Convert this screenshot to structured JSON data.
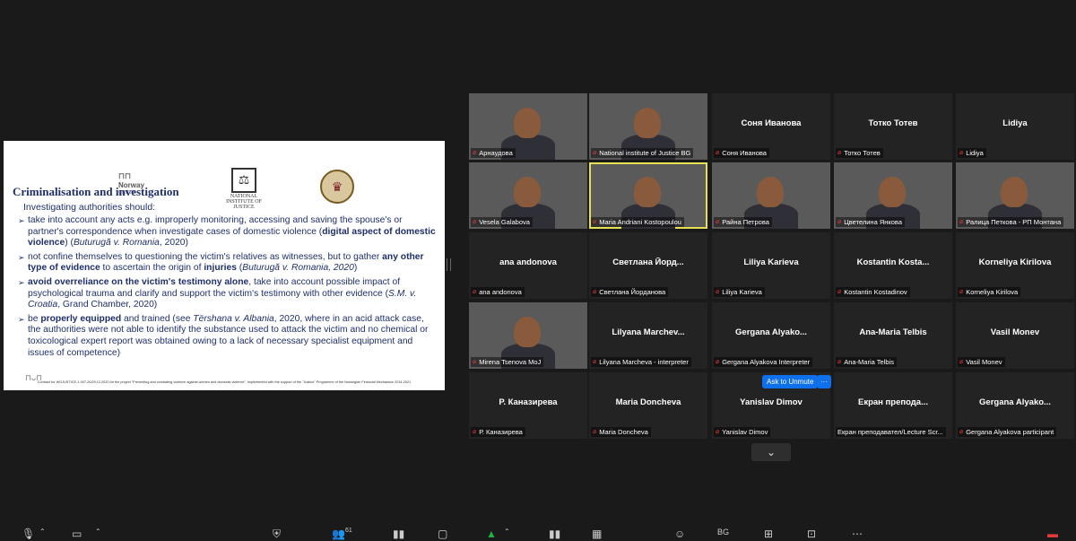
{
  "slide": {
    "logo_norway": "Norway",
    "logo_norway_sub": "grants",
    "logo_nij": "NATIONAL INSTITUTE OF JUSTICE",
    "title": "Criminalisation and investigation",
    "intro": "Investigating authorities should:",
    "bullets": [
      {
        "parts": [
          {
            "t": "take into account any acts e.g. improperly monitoring, accessing and saving the spouse's or partner's correspondence when investigate cases of domestic violence ("
          },
          {
            "t": "digital aspect of domestic violence",
            "b": true
          },
          {
            "t": ") ("
          },
          {
            "t": "Buturugă v. Romania",
            "i": true
          },
          {
            "t": ", 2020)"
          }
        ]
      },
      {
        "parts": [
          {
            "t": "not confine themselves to questioning the victim's relatives as witnesses, but to gather "
          },
          {
            "t": "any other type of evidence",
            "b": true
          },
          {
            "t": " to ascertain the origin of "
          },
          {
            "t": "injuries",
            "b": true
          },
          {
            "t": " ("
          },
          {
            "t": "Buturugă v. Romania, 2020",
            "i": true
          },
          {
            "t": ")"
          }
        ]
      },
      {
        "parts": [
          {
            "t": "avoid overreliance on the victim's testimony alone",
            "b": true
          },
          {
            "t": ", take into account possible impact of psychological trauma and clarify and support the victim's testimony with other evidence ("
          },
          {
            "t": "S.M. v. Croatia",
            "i": true
          },
          {
            "t": ", Grand Chamber, 2020)"
          }
        ]
      },
      {
        "parts": [
          {
            "t": "be "
          },
          {
            "t": "properly equipped",
            "b": true
          },
          {
            "t": " and trained (see "
          },
          {
            "t": "Tërshana v. Albania",
            "i": true
          },
          {
            "t": ", 2020, where in an acid attack case, the authorities were not able to identify the substance used to attack the victim and no chemical or toxicological  expert report was obtained owing to a lack of necessary specialist equipment and issues of competence)"
          }
        ]
      }
    ],
    "footer": "Contract for WGJUSTICE-1-007-20/29.12.2020 for the project \"Preventing and combating violence against women and domestic violence\", implemented with the support of the \"Justice\" Programme of the Norwegian Financial Mechanism 2014-2021"
  },
  "participants": [
    {
      "label": "Арнаудова",
      "video": true,
      "bg": "bg-light"
    },
    {
      "label": "National institute of Justice BG",
      "video": true,
      "bg": "bg-flag"
    },
    {
      "label": "Соня Иванова",
      "name": "Соня Иванова",
      "video": false
    },
    {
      "label": "Тотко Тотев",
      "name": "Тотко Тотев",
      "video": false
    },
    {
      "label": "Lidiya",
      "name": "Lidiya",
      "video": false
    },
    {
      "label": "Vesela Galabova",
      "video": true,
      "bg": "bg-room"
    },
    {
      "label": "Maria Andriani Kostopoulou",
      "video": true,
      "bg": "bg-books",
      "active": true
    },
    {
      "label": "Райна Петрова",
      "video": true,
      "bg": "bg-office"
    },
    {
      "label": "Цветелина Янкова",
      "video": true,
      "bg": "bg-light"
    },
    {
      "label": "Ралица Петкова - РП Монтана",
      "video": true,
      "bg": "bg-office"
    },
    {
      "label": "ana andonova",
      "name": "ana andonova",
      "video": false
    },
    {
      "label": "Светлана Йорданова",
      "name": "Светлана  Йорд...",
      "video": false
    },
    {
      "label": "Liliya Karieva",
      "name": "Liliya Karieva",
      "video": false
    },
    {
      "label": "Kostantin Kostadinov",
      "name": "Kostantin  Kosta...",
      "video": false
    },
    {
      "label": "Korneliya Kirilova",
      "name": "Korneliya Kirilova",
      "video": false
    },
    {
      "label": "Mirena Tsenova MoJ",
      "video": true,
      "bg": "bg-room"
    },
    {
      "label": "Lilyana Marcheva - interpreter",
      "name": "Lilyana  Marchev...",
      "video": false
    },
    {
      "label": "Gergana Alyakova Interpreter",
      "name": "Gergana  Alyako...",
      "video": false
    },
    {
      "label": "Ana-Maria Telbis",
      "name": "Ana-Maria Telbis",
      "video": false
    },
    {
      "label": "Vasil Monev",
      "name": "Vasil Monev",
      "video": false
    },
    {
      "label": "Р. Каназирева",
      "name": "Р. Каназирева",
      "video": false
    },
    {
      "label": "Maria Doncheva",
      "name": "Maria Doncheva",
      "video": false
    },
    {
      "label": "Yanislav Dimov",
      "name": "Yanislav Dimov",
      "video": false
    },
    {
      "label": "Екран преподавател/Lecture Scr...",
      "name": "Екран  препода...",
      "video": false,
      "no_mic": true
    },
    {
      "label": "Gergana Alyakova participant",
      "name": "Gergana  Alyako...",
      "video": false
    }
  ],
  "hover_controls": {
    "ask_to_unmute": "Ask to Unmute",
    "more": "···"
  },
  "toolbar": {
    "participants_count": "61",
    "language": "BG"
  }
}
